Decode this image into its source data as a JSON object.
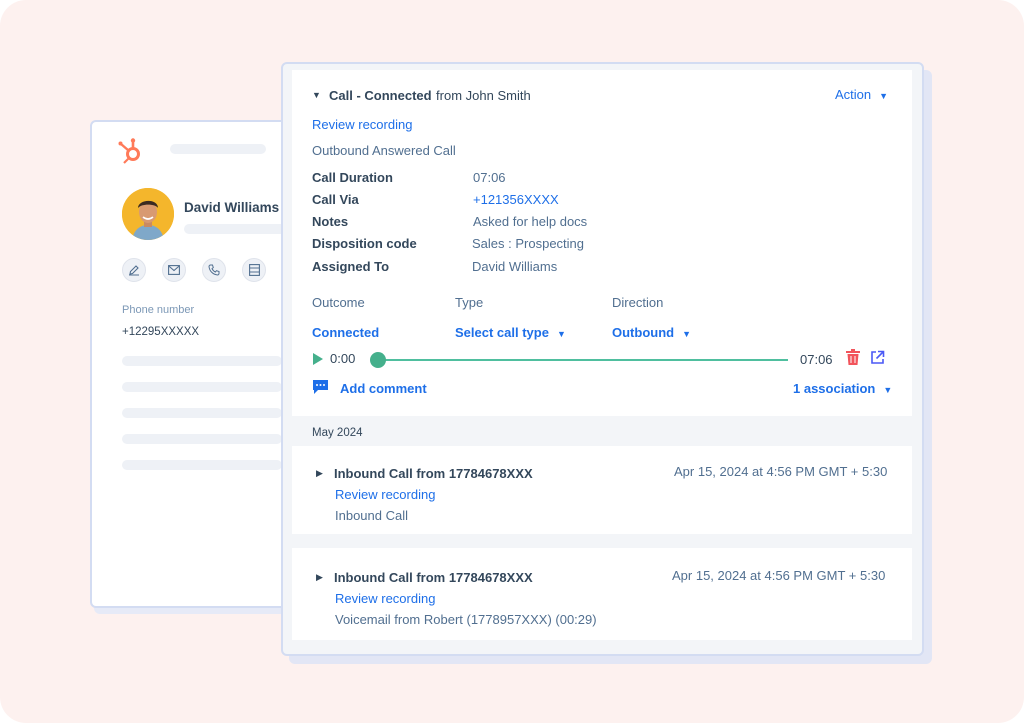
{
  "contact": {
    "name": "David Williams",
    "phone_label": "Phone number",
    "phone_value": "+12295XXXXX"
  },
  "call": {
    "title_strong": "Call - Connected",
    "title_rest": "from John Smith",
    "action_label": "Action",
    "review_label": "Review recording",
    "subtitle": "Outbound Answered Call",
    "details": [
      {
        "label": "Call Duration",
        "value": "07:06"
      },
      {
        "label": "Call Via",
        "value": "+121356XXXX"
      },
      {
        "label": "Notes",
        "value": "Asked for help docs"
      },
      {
        "label": "Disposition code",
        "value": "Sales : Prospecting"
      },
      {
        "label": "Assigned To",
        "value": "David Williams"
      }
    ],
    "fields": {
      "outcome_label": "Outcome",
      "outcome_value": "Connected",
      "type_label": "Type",
      "type_value": "Select call type",
      "direction_label": "Direction",
      "direction_value": "Outbound"
    },
    "player": {
      "current": "0:00",
      "total": "07:06",
      "progress": 0
    },
    "add_comment": "Add comment",
    "association": "1 association"
  },
  "month": "May 2024",
  "logs": [
    {
      "title": "Inbound Call from 17784678XXX",
      "timestamp": "Apr 15, 2024 at 4:56 PM GMT + 5:30",
      "review": "Review recording",
      "subtitle": "Inbound Call"
    },
    {
      "title": "Inbound Call from 17784678XXX",
      "timestamp": "Apr 15, 2024 at 4:56 PM GMT + 5:30",
      "review": "Review recording",
      "subtitle": "Voicemail from Robert (1778957XXX) (00:29)"
    }
  ],
  "colors": {
    "accent": "#1e6fe8",
    "progress": "#4fbf9f",
    "hubspot": "#ff7a59",
    "delete": "#f2545b",
    "avatar_bg": "#f4b62c"
  }
}
